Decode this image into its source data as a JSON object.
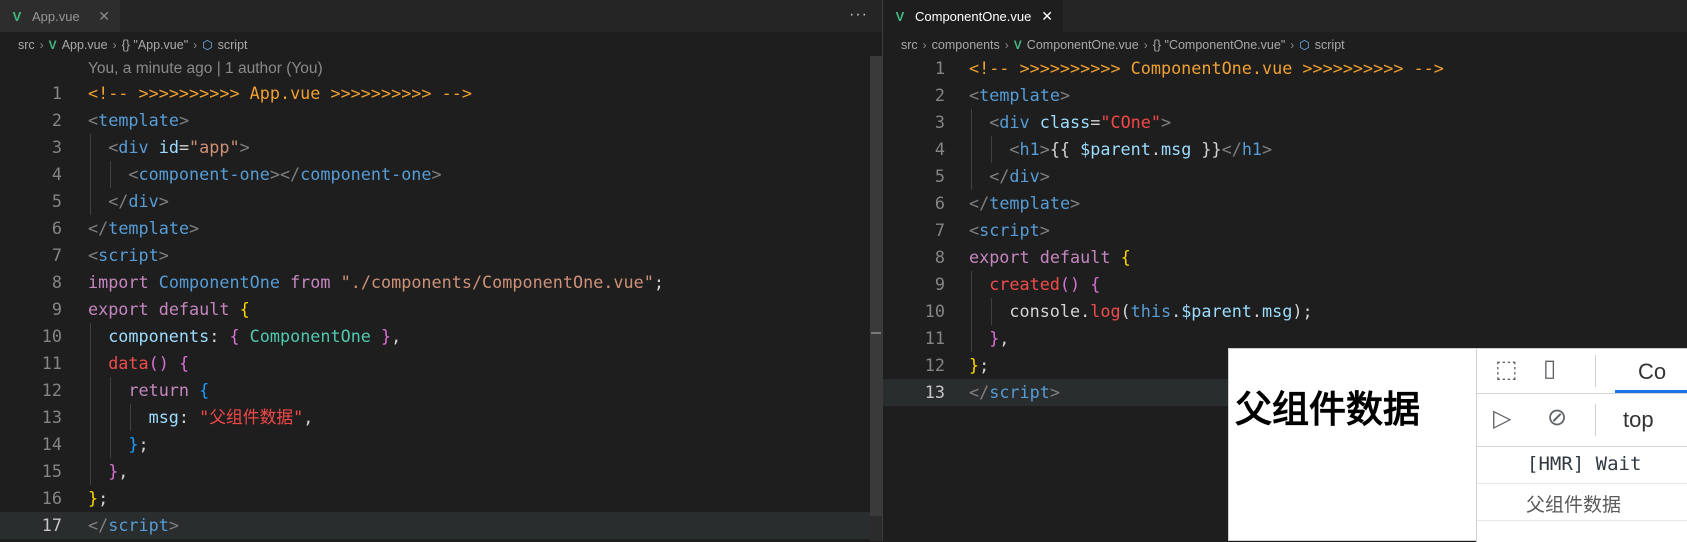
{
  "left_editor": {
    "tab": {
      "label": "App.vue",
      "icon": "vue-icon"
    },
    "more_label": "···",
    "breadcrumb": [
      "src",
      "App.vue",
      "{} \"App.vue\"",
      "script"
    ],
    "blame": "You, a minute ago | 1 author (You)",
    "lines": [
      {
        "n": "1",
        "active": false,
        "indent": 0,
        "tokens": [
          [
            "c-comment",
            "<!-- >>>>>>>>>> App.vue >>>>>>>>>> -->"
          ]
        ]
      },
      {
        "n": "2",
        "active": false,
        "indent": 0,
        "tokens": [
          [
            "c-punct",
            "<"
          ],
          [
            "c-tag",
            "template"
          ],
          [
            "c-punct",
            ">"
          ]
        ]
      },
      {
        "n": "3",
        "active": false,
        "indent": 1,
        "tokens": [
          [
            "c-punct",
            "<"
          ],
          [
            "c-tag",
            "div "
          ],
          [
            "c-attr",
            "id"
          ],
          [
            "c-plain",
            "="
          ],
          [
            "c-str",
            "\"app\""
          ],
          [
            "c-punct",
            ">"
          ]
        ]
      },
      {
        "n": "4",
        "active": false,
        "indent": 2,
        "tokens": [
          [
            "c-punct",
            "<"
          ],
          [
            "c-tag",
            "component-one"
          ],
          [
            "c-punct",
            "></"
          ],
          [
            "c-tag",
            "component-one"
          ],
          [
            "c-punct",
            ">"
          ]
        ]
      },
      {
        "n": "5",
        "active": false,
        "indent": 1,
        "tokens": [
          [
            "c-punct",
            "</"
          ],
          [
            "c-tag",
            "div"
          ],
          [
            "c-punct",
            ">"
          ]
        ]
      },
      {
        "n": "6",
        "active": false,
        "indent": 0,
        "tokens": [
          [
            "c-punct",
            "</"
          ],
          [
            "c-tag",
            "template"
          ],
          [
            "c-punct",
            ">"
          ]
        ]
      },
      {
        "n": "7",
        "active": false,
        "indent": 0,
        "tokens": [
          [
            "c-punct",
            "<"
          ],
          [
            "c-tag",
            "script"
          ],
          [
            "c-punct",
            ">"
          ]
        ]
      },
      {
        "n": "8",
        "active": false,
        "indent": 0,
        "tokens": [
          [
            "c-import",
            "import "
          ],
          [
            "c-tag",
            "ComponentOne "
          ],
          [
            "c-import",
            "from "
          ],
          [
            "c-str",
            "\"./components/ComponentOne.vue\""
          ],
          [
            "c-plain",
            ";"
          ]
        ]
      },
      {
        "n": "9",
        "active": false,
        "indent": 0,
        "tokens": [
          [
            "c-import",
            "export default "
          ],
          [
            "c-brace-y",
            "{"
          ]
        ]
      },
      {
        "n": "10",
        "active": false,
        "indent": 1,
        "tokens": [
          [
            "c-key",
            "components"
          ],
          [
            "c-plain",
            ": "
          ],
          [
            "c-brace-p",
            "{ "
          ],
          [
            "c-cls",
            "ComponentOne "
          ],
          [
            "c-brace-p",
            "}"
          ],
          [
            "c-plain",
            ","
          ]
        ]
      },
      {
        "n": "11",
        "active": false,
        "indent": 1,
        "tokens": [
          [
            "c-fn",
            "data"
          ],
          [
            "c-brace-p",
            "()"
          ],
          [
            "c-plain",
            " "
          ],
          [
            "c-brace-p",
            "{"
          ]
        ]
      },
      {
        "n": "12",
        "active": false,
        "indent": 2,
        "tokens": [
          [
            "c-import",
            "return "
          ],
          [
            "c-brace-b",
            "{"
          ]
        ]
      },
      {
        "n": "13",
        "active": false,
        "indent": 3,
        "tokens": [
          [
            "c-key",
            "msg"
          ],
          [
            "c-plain",
            ": "
          ],
          [
            "c-strred",
            "\"父组件数据\""
          ],
          [
            "c-plain",
            ","
          ]
        ]
      },
      {
        "n": "14",
        "active": false,
        "indent": 2,
        "tokens": [
          [
            "c-brace-b",
            "}"
          ],
          [
            "c-plain",
            ";"
          ]
        ]
      },
      {
        "n": "15",
        "active": false,
        "indent": 1,
        "tokens": [
          [
            "c-brace-p",
            "}"
          ],
          [
            "c-plain",
            ","
          ]
        ]
      },
      {
        "n": "16",
        "active": false,
        "indent": 0,
        "tokens": [
          [
            "c-brace-y",
            "}"
          ],
          [
            "c-plain",
            ";"
          ]
        ]
      },
      {
        "n": "17",
        "active": true,
        "indent": 0,
        "tokens": [
          [
            "c-punct",
            "</"
          ],
          [
            "c-tag",
            "script"
          ],
          [
            "c-punct",
            ">"
          ]
        ]
      }
    ]
  },
  "right_editor": {
    "tab": {
      "label": "ComponentOne.vue",
      "icon": "vue-icon"
    },
    "breadcrumb": [
      "src",
      "components",
      "ComponentOne.vue",
      "{} \"ComponentOne.vue\"",
      "script"
    ],
    "lines": [
      {
        "n": "1",
        "active": false,
        "indent": 0,
        "tokens": [
          [
            "c-comment",
            "<!-- >>>>>>>>>> ComponentOne.vue >>>>>>>>>> -->"
          ]
        ]
      },
      {
        "n": "2",
        "active": false,
        "indent": 0,
        "tokens": [
          [
            "c-punct",
            "<"
          ],
          [
            "c-tag",
            "template"
          ],
          [
            "c-punct",
            ">"
          ]
        ]
      },
      {
        "n": "3",
        "active": false,
        "indent": 1,
        "tokens": [
          [
            "c-punct",
            "<"
          ],
          [
            "c-tag",
            "div "
          ],
          [
            "c-attr",
            "class"
          ],
          [
            "c-plain",
            "="
          ],
          [
            "c-strred",
            "\"COne\""
          ],
          [
            "c-punct",
            ">"
          ]
        ]
      },
      {
        "n": "4",
        "active": false,
        "indent": 2,
        "tokens": [
          [
            "c-punct",
            "<"
          ],
          [
            "c-tag",
            "h1"
          ],
          [
            "c-punct",
            ">"
          ],
          [
            "c-plain",
            "{{ "
          ],
          [
            "c-var",
            "$parent"
          ],
          [
            "c-plain",
            "."
          ],
          [
            "c-var",
            "msg"
          ],
          [
            "c-plain",
            " }}"
          ],
          [
            "c-punct",
            "</"
          ],
          [
            "c-tag",
            "h1"
          ],
          [
            "c-punct",
            ">"
          ]
        ]
      },
      {
        "n": "5",
        "active": false,
        "indent": 1,
        "tokens": [
          [
            "c-punct",
            "</"
          ],
          [
            "c-tag",
            "div"
          ],
          [
            "c-punct",
            ">"
          ]
        ]
      },
      {
        "n": "6",
        "active": false,
        "indent": 0,
        "tokens": [
          [
            "c-punct",
            "</"
          ],
          [
            "c-tag",
            "template"
          ],
          [
            "c-punct",
            ">"
          ]
        ]
      },
      {
        "n": "7",
        "active": false,
        "indent": 0,
        "tokens": [
          [
            "c-punct",
            "<"
          ],
          [
            "c-tag",
            "script"
          ],
          [
            "c-punct",
            ">"
          ]
        ]
      },
      {
        "n": "8",
        "active": false,
        "indent": 0,
        "tokens": [
          [
            "c-import",
            "export default "
          ],
          [
            "c-brace-y",
            "{"
          ]
        ]
      },
      {
        "n": "9",
        "active": false,
        "indent": 1,
        "tokens": [
          [
            "c-fn",
            "created"
          ],
          [
            "c-brace-p",
            "()"
          ],
          [
            "c-plain",
            " "
          ],
          [
            "c-brace-p",
            "{"
          ]
        ]
      },
      {
        "n": "10",
        "active": false,
        "indent": 2,
        "tokens": [
          [
            "c-plain",
            "console"
          ],
          [
            "c-plain",
            "."
          ],
          [
            "c-fn",
            "log"
          ],
          [
            "c-plain",
            "("
          ],
          [
            "c-this",
            "this"
          ],
          [
            "c-plain",
            "."
          ],
          [
            "c-var",
            "$parent"
          ],
          [
            "c-plain",
            "."
          ],
          [
            "c-var",
            "msg"
          ],
          [
            "c-plain",
            ");"
          ]
        ]
      },
      {
        "n": "11",
        "active": false,
        "indent": 1,
        "tokens": [
          [
            "c-brace-p",
            "}"
          ],
          [
            "c-plain",
            ","
          ]
        ]
      },
      {
        "n": "12",
        "active": false,
        "indent": 0,
        "tokens": [
          [
            "c-brace-y",
            "}"
          ],
          [
            "c-plain",
            ";"
          ]
        ]
      },
      {
        "n": "13",
        "active": true,
        "indent": 0,
        "tokens": [
          [
            "c-punct",
            "</"
          ],
          [
            "c-tag",
            "script"
          ],
          [
            "c-punct",
            ">"
          ]
        ]
      }
    ]
  },
  "preview": {
    "page_heading": "父组件数据",
    "devtools": {
      "inspect_icon": "inspect-element-icon",
      "device_icon": "device-toolbar-icon",
      "tab_label": "Co",
      "run_icon": "sidebar-toggle-icon",
      "clear_icon": "clear-console-icon",
      "context_label": "top",
      "console_lines": [
        "[HMR] Wait",
        "父组件数据"
      ]
    }
  },
  "colors": {
    "editor_bg": "#1e1e1e",
    "tab_bar_bg": "#252526",
    "vue_green": "#41b883",
    "comment_orange": "#f0a030",
    "devtools_accent": "#1a73e8"
  }
}
